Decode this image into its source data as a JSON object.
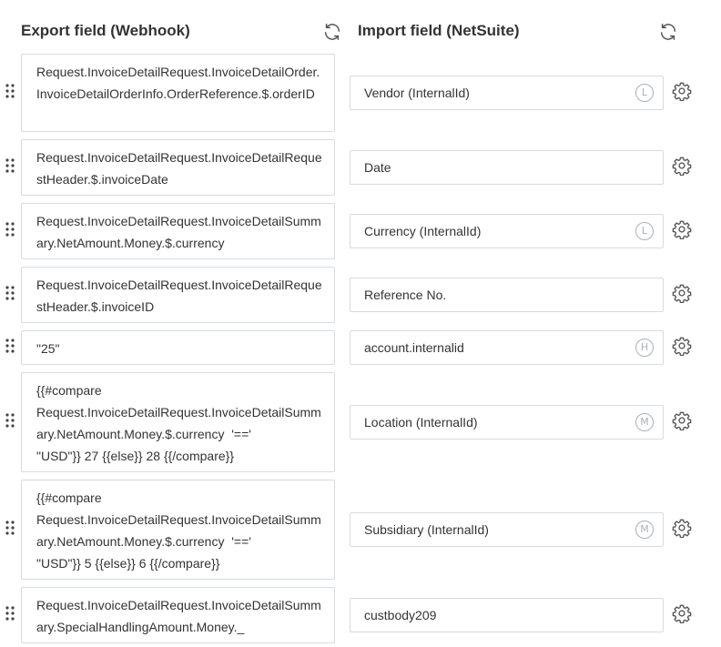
{
  "header": {
    "export_title": "Export field (Webhook)",
    "import_title": "Import field (NetSuite)"
  },
  "icons": {
    "refresh": "refresh-icon",
    "settings": "gear-icon",
    "drag": "drag-handle-icon"
  },
  "colors": {
    "border": "#d6dbe0",
    "text": "#333333",
    "icon": "#555555",
    "badge": "#a9b1b8"
  },
  "mappings": [
    {
      "export": "Request.InvoiceDetailRequest.InvoiceDetailOrder.InvoiceDetailOrderInfo.OrderReference.$.orderID",
      "import": "Vendor (InternalId)",
      "badge": "L"
    },
    {
      "export": "Request.InvoiceDetailRequest.InvoiceDetailRequestHeader.$.invoiceDate",
      "import": "Date",
      "badge": ""
    },
    {
      "export": "Request.InvoiceDetailRequest.InvoiceDetailSummary.NetAmount.Money.$.currency",
      "import": "Currency (InternalId)",
      "badge": "L"
    },
    {
      "export": "Request.InvoiceDetailRequest.InvoiceDetailRequestHeader.$.invoiceID",
      "import": "Reference No.",
      "badge": ""
    },
    {
      "export": "\"25\"",
      "import": "account.internalid",
      "badge": "H"
    },
    {
      "export": "{{#compare\nRequest.InvoiceDetailRequest.InvoiceDetailSummary.NetAmount.Money.$.currency  '=='\n\"USD\"}} 27 {{else}} 28 {{/compare}}",
      "import": "Location (InternalId)",
      "badge": "M"
    },
    {
      "export": "{{#compare\nRequest.InvoiceDetailRequest.InvoiceDetailSummary.NetAmount.Money.$.currency  '=='\n\"USD\"}} 5 {{else}} 6 {{/compare}}",
      "import": "Subsidiary (InternalId)",
      "badge": "M"
    },
    {
      "export": "Request.InvoiceDetailRequest.InvoiceDetailSummary.SpecialHandlingAmount.Money._",
      "import": "custbody209",
      "badge": ""
    }
  ]
}
